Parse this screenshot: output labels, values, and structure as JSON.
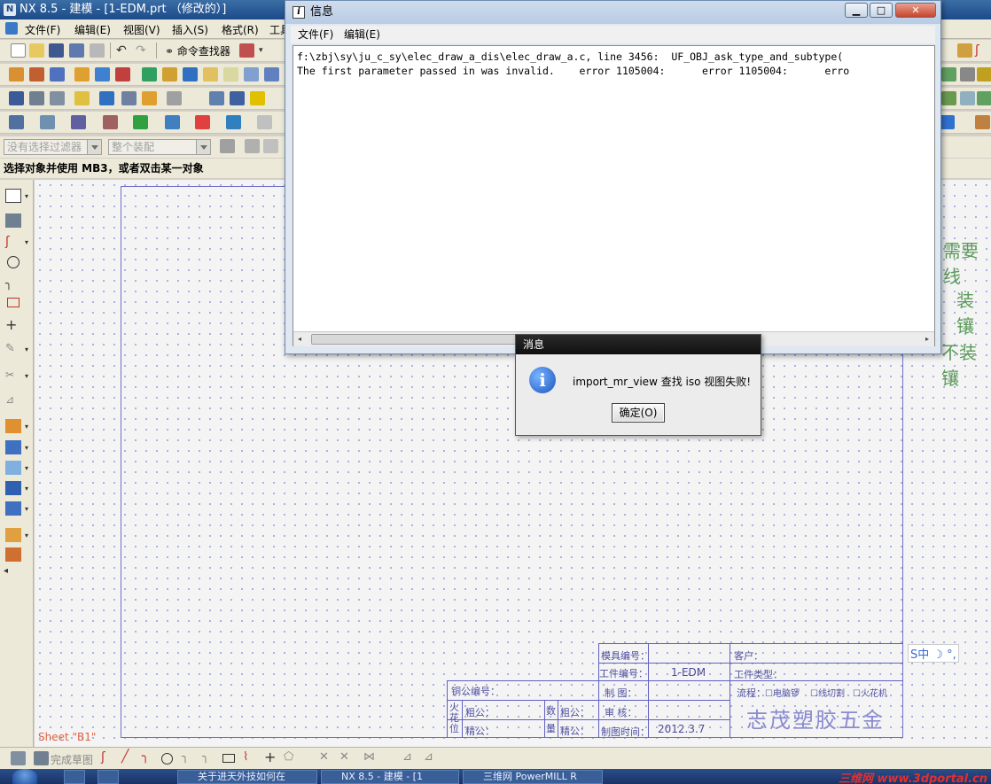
{
  "window": {
    "title": "NX 8.5 - 建模 - [1-EDM.prt （修改的）]"
  },
  "menubar": {
    "items": [
      "文件(F)",
      "编辑(E)",
      "视图(V)",
      "插入(S)",
      "格式(R)",
      "工具"
    ]
  },
  "toolbar": {
    "command_finder": "命令查找器"
  },
  "filterbar": {
    "filter_placeholder": "没有选择过滤器",
    "assembly_scope": "整个装配"
  },
  "cue_line": "选择对象并使用 MB3，或者双击某一对象",
  "info_window": {
    "title": "信息",
    "menu": [
      "文件(F)",
      "编辑(E)"
    ],
    "lines": [
      "f:\\zbj\\sy\\ju_c_sy\\elec_draw_a_dis\\elec_draw_a.c, line 3456:  UF_OBJ_ask_type_and_subtype(",
      "The first parameter passed in was invalid.    error 1105004:      error 1105004:      erro"
    ],
    "buttons": {
      "minimize": "▁",
      "maximize": "□",
      "close": "✕"
    }
  },
  "message_box": {
    "title": "消息",
    "message": "import_mr_view 查找 iso 视图失败!",
    "ok_label": "确定(O)"
  },
  "drawing": {
    "sheet_label": "Sheet \"B1\"",
    "side_notes": [
      "需要线",
      "装镶",
      "不装镶"
    ],
    "title_block": {
      "mold_number_label": "模具编号：",
      "part_number_label": "工件编号：",
      "part_number_value": "1-EDM",
      "drawn_label": "制  图：",
      "review_label": "审  核：",
      "draw_time_label": "制图时间：",
      "draw_time_value": "2012.3.7",
      "customer_label": "客户：",
      "part_type_label": "工件类型：",
      "process_label": "流程：",
      "process_options": [
        "电脑锣",
        "线切割",
        "火花机"
      ],
      "electrode_number_label": "铜公编号：",
      "spark_label": "火花位",
      "rough_label": "粗公：",
      "fine_label": "精公：",
      "quantity_label": "数量",
      "qty_rough_label": "粗公：",
      "qty_fine_label": "精公：",
      "company": "志茂塑胶五金"
    }
  },
  "bottom_toolbar": {
    "finish_sketch": "完成草图"
  },
  "taskbar": {
    "tasks": [
      "关于进天外技如何在",
      "NX 8.5 - 建模 - [1",
      "三维网 PowerMILL R"
    ],
    "watermark": "三维网 www.3dportal.cn",
    "ime": "S中 ☽ °,"
  },
  "colors": {
    "sheet_border": "#7070c8",
    "title_block": "#6060c0",
    "sheet_label": "#e06040",
    "side_notes": "#5a9a5a",
    "watermark": "#e23030"
  }
}
